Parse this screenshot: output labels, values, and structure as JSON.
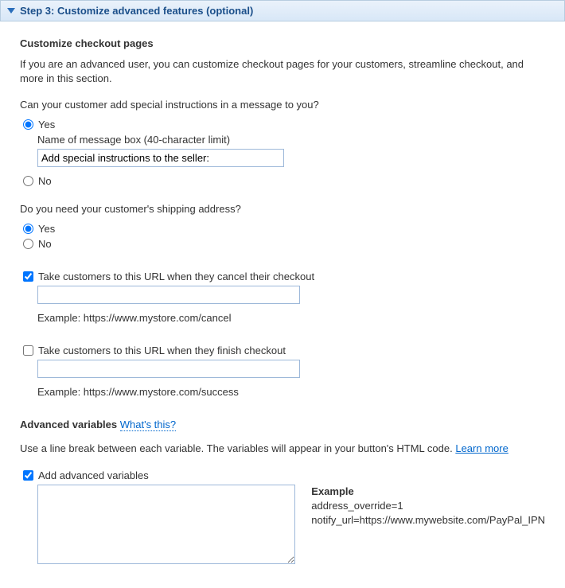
{
  "header": {
    "title": "Step 3: Customize advanced features (optional)"
  },
  "checkout": {
    "section_title": "Customize checkout pages",
    "intro": "If you are an advanced user, you can customize checkout pages for your customers, streamline checkout, and more in this section.",
    "q_instructions": "Can your customer add special instructions in a message to you?",
    "yes": "Yes",
    "no": "No",
    "msg_label": "Name of message box (40-character limit)",
    "msg_value": "Add special instructions to the seller:",
    "q_shipping": "Do you need your customer's shipping address?",
    "cancel_label": "Take customers to this URL when they cancel their checkout",
    "cancel_example": "Example: https://www.mystore.com/cancel",
    "finish_label": "Take customers to this URL when they finish checkout",
    "finish_example": "Example: https://www.mystore.com/success"
  },
  "advanced": {
    "title": "Advanced variables",
    "whats_this": "What's this?",
    "intro_a": "Use a line break between each variable. The variables will appear in your button's HTML code. ",
    "learn_more": "Learn more",
    "checkbox_label": "Add advanced variables",
    "example_title": "Example",
    "example_line1": "address_override=1",
    "example_line2": "notify_url=https://www.mywebsite.com/PayPal_IPN"
  }
}
